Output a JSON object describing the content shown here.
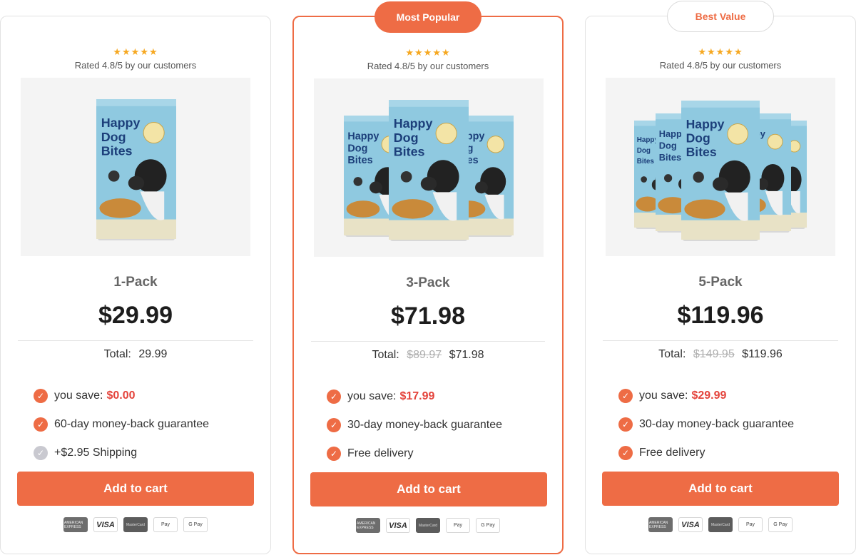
{
  "colors": {
    "accent": "#ee6c45",
    "save": "#e4433b",
    "star": "#f6a821"
  },
  "cards": [
    {
      "badge": "",
      "stars": "★★★★★",
      "rating": "Rated 4.8/5 by our customers",
      "image_icon": "dog-food-bag-single",
      "brand_lines": [
        "Happy",
        "Dog",
        "Bites"
      ],
      "pack": "1-Pack",
      "price": "$29.99",
      "total_label": "Total:",
      "total_old": "",
      "total_now": "29.99",
      "save_label": "you save:",
      "save_value": "$0.00",
      "guarantee": "60-day money-back guarantee",
      "delivery": "+$2.95 Shipping",
      "delivery_icon": "check-circle-muted-icon",
      "cta": "Add to cart"
    },
    {
      "badge": "Most Popular",
      "stars": "★★★★★",
      "rating": "Rated 4.8/5 by our customers",
      "image_icon": "dog-food-bags-three",
      "brand_lines": [
        "Happy",
        "Dog",
        "Bites"
      ],
      "pack": "3-Pack",
      "price": "$71.98",
      "total_label": "Total:",
      "total_old": "$89.97",
      "total_now": "$71.98",
      "save_label": "you save:",
      "save_value": "$17.99",
      "guarantee": "30-day money-back guarantee",
      "delivery": "Free delivery",
      "delivery_icon": "check-circle-icon",
      "cta": "Add to cart"
    },
    {
      "badge": "Best Value",
      "stars": "★★★★★",
      "rating": "Rated 4.8/5 by our customers",
      "image_icon": "dog-food-bags-five",
      "brand_lines": [
        "Happy",
        "Dog",
        "Bites"
      ],
      "pack": "5-Pack",
      "price": "$119.96",
      "total_label": "Total:",
      "total_old": "$149.95",
      "total_now": "$119.96",
      "save_label": "you save:",
      "save_value": "$29.99",
      "guarantee": "30-day money-back guarantee",
      "delivery": "Free delivery",
      "delivery_icon": "check-circle-icon",
      "cta": "Add to cart"
    }
  ],
  "payments": [
    {
      "name": "amex-icon",
      "label": "AMERICAN EXPRESS"
    },
    {
      "name": "visa-icon",
      "label": "VISA"
    },
    {
      "name": "mastercard-icon",
      "label": "MasterCard"
    },
    {
      "name": "apple-pay-icon",
      "label": " Pay"
    },
    {
      "name": "google-pay-icon",
      "label": "G Pay"
    }
  ]
}
